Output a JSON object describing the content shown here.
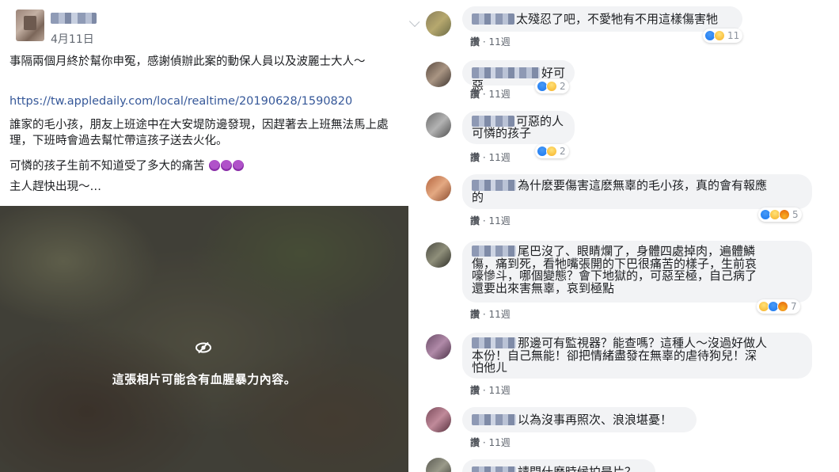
{
  "post": {
    "date": "4月11日",
    "paragraph1": "事隔兩個月終於幫你申冤，感謝偵辦此案的動保人員以及波麗士大人～",
    "link": "https://tw.appledaily.com/local/realtime/20190628/1590820",
    "paragraph2": "誰家的毛小孩，朋友上班途中在大安堤防邊發現，因趕著去上班無法馬上處理，下班時會過去幫忙帶這孩子送去火化。",
    "paragraph3": "可憐的孩子生前不知道受了多大的痛苦",
    "paragraph4": "主人趕快出現～…",
    "photo_warning": "這張相片可能含有血腥暴力內容。"
  },
  "comments": [
    {
      "text": "太殘忍了吧，不愛牠有不用這樣傷害牠",
      "like_label": "讚",
      "time": "11週",
      "reactions": [
        "like",
        "sad"
      ],
      "count": "11"
    },
    {
      "text": "好可惡",
      "like_label": "讚",
      "time": "11週",
      "reactions": [
        "like",
        "sad"
      ],
      "count": "2"
    },
    {
      "text": "可惡的人",
      "text2": "可憐的孩子",
      "like_label": "讚",
      "time": "11週",
      "reactions": [
        "like",
        "sad"
      ],
      "count": "2"
    },
    {
      "text": "為什麽要傷害這麽無辜的毛小孩，真的會有報應",
      "text2": "的",
      "like_label": "讚",
      "time": "11週",
      "reactions": [
        "like",
        "sad",
        "angry"
      ],
      "count": "5"
    },
    {
      "text": "尾巴沒了、眼睛爛了，身體四處掉肉，遍體鱗",
      "text2": "傷，痛到死，看牠嘴張開的下巴很痛苦的樣子，生前哀",
      "text3": "嚎慘斗，哪個變態？會下地獄的，可惡至極，自己病了",
      "text4": "還要出來害無辜，哀到極點",
      "like_label": "讚",
      "time": "11週",
      "reactions": [
        "sad",
        "like",
        "angry"
      ],
      "count": "7"
    },
    {
      "text": "那邊可有監視器？能查嗎？這種人～沒過好做人",
      "text2": "本份！自己無能！卻把情緒盡發在無辜的虐待狗兒！深",
      "text3": "怕他ㄦ",
      "like_label": "讚",
      "time": "11週"
    },
    {
      "text": "以為沒事再照次、浪浪堪憂！",
      "like_label": "讚",
      "time": "11週"
    },
    {
      "text": "請問什麼時候拍是片？"
    }
  ],
  "colors": {
    "link": "#365899",
    "bubble": "#f2f3f5",
    "meta": "#616770"
  }
}
